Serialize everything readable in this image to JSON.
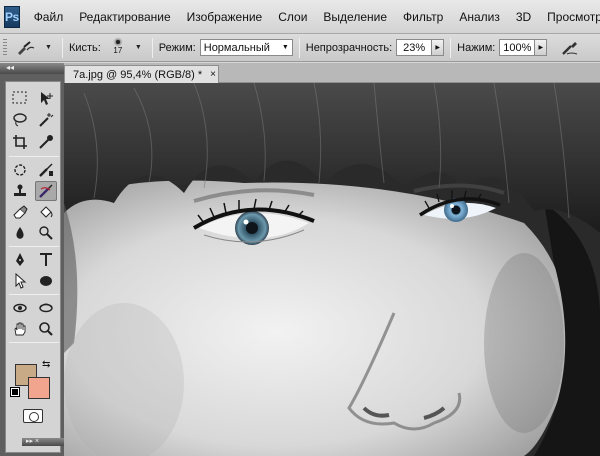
{
  "app": {
    "logo": "Ps",
    "menu": [
      "Файл",
      "Редактирование",
      "Изображение",
      "Слои",
      "Выделение",
      "Фильтр",
      "Анализ",
      "3D",
      "Просмотр"
    ]
  },
  "options": {
    "brush_label": "Кисть:",
    "brush_size": "17",
    "mode_label": "Режим:",
    "mode_value": "Нормальный",
    "opacity_label": "Непрозрачность:",
    "opacity_value": "23%",
    "pressure_label": "Нажим:",
    "pressure_value": "100%"
  },
  "document": {
    "tab_title": "7a.jpg @ 95,4% (RGB/8) *",
    "close_glyph": "×"
  },
  "tools": {
    "foreground_color": "#c8aa86",
    "background_color": "#f1a48e",
    "active_tool": "color-replacement-brush"
  }
}
